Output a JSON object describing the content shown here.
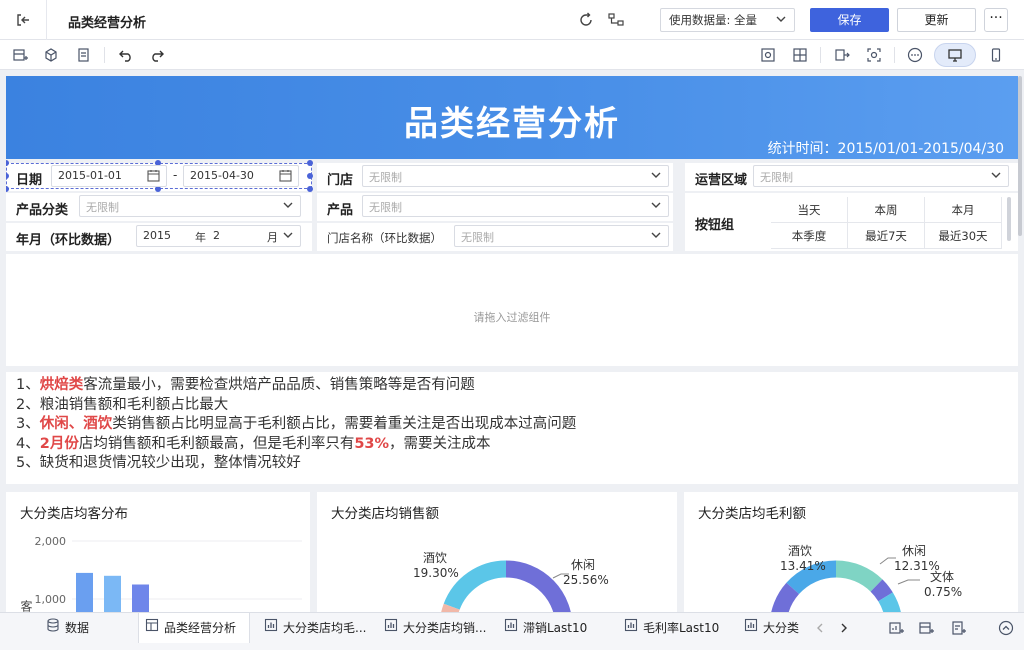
{
  "header": {
    "title": "品类经营分析",
    "data_amount_label": "使用数据量: 全量",
    "save_label": "保存",
    "update_label": "更新",
    "more_label": "···"
  },
  "banner": {
    "title": "品类经营分析",
    "stat_time": "统计时间：2015/01/01-2015/04/30"
  },
  "filters": {
    "date_label": "日期",
    "date_start": "2015-01-01",
    "date_sep": "-",
    "date_end": "2015-04-30",
    "store_label": "门店",
    "store_value": "无限制",
    "region_label": "运营区域",
    "region_value": "无限制",
    "category_label": "产品分类",
    "category_value": "无限制",
    "product_label": "产品",
    "product_value": "无限制",
    "yearmonth_label": "年月（环比数据）",
    "year_value": "2015",
    "year_unit": "年",
    "month_value": "2",
    "month_unit": "月",
    "store_name_label": "门店名称（环比数据）",
    "store_name_value": "无限制",
    "button_group_label": "按钮组",
    "buttons": [
      "当天",
      "本周",
      "本月",
      "本季度",
      "最近7天",
      "最近30天"
    ]
  },
  "drop_hint": "请拖入过滤组件",
  "notes": {
    "l1_prefix": "1、",
    "l1_hl": "烘焙类",
    "l1_rest": "客流量最小，需要检查烘焙产品品质、销售策略等是否有问题",
    "l2": "2、粮油销售额和毛利额占比最大",
    "l3_prefix": "3、",
    "l3_hl": "休闲、酒饮",
    "l3_rest": "类销售额占比明显高于毛利额占比，需要着重关注是否出现成本过高问题",
    "l4_prefix": "4、",
    "l4_hl1": "2月份",
    "l4_mid": "店均销售额和毛利额最高，但是毛利率只有",
    "l4_hl2": "53%",
    "l4_rest": "，需要关注成本",
    "l5": "5、缺货和退货情况较少出现，整体情况较好"
  },
  "cards": {
    "card1_title": "大分类店均客分布",
    "card2_title": "大分类店均销售额",
    "card3_title": "大分类店均毛利额"
  },
  "chart_data": [
    {
      "type": "bar",
      "title": "大分类店均客分布",
      "ylabel": "客流量",
      "yticks": [
        "2,000",
        "1,000"
      ],
      "series": [
        {
          "values": [
            1450,
            1400,
            1250
          ]
        }
      ],
      "colors": [
        "#6a9ff0",
        "#7bb8f5",
        "#6f86ea"
      ]
    },
    {
      "type": "pie",
      "title": "大分类店均销售额",
      "labels": [
        "酒饮",
        "休闲"
      ],
      "values_text": [
        "19.30%",
        "25.56%"
      ],
      "values": [
        19.3,
        25.56
      ],
      "colors": [
        "#5bc6e8",
        "#6f6fd8",
        "#f1b8a8"
      ]
    },
    {
      "type": "pie",
      "title": "大分类店均毛利额",
      "labels": [
        "酒饮",
        "休闲",
        "文体"
      ],
      "values_text": [
        "13.41%",
        "12.31%",
        "0.75%"
      ],
      "values": [
        13.41,
        12.31,
        0.75
      ],
      "colors": [
        "#4aa8e8",
        "#7fd4c4",
        "#6f6fd8",
        "#5bc6e8"
      ]
    }
  ],
  "bottom_tabs": {
    "data": "数据",
    "tab1": "品类经营分析",
    "tab2": "大分类店均毛...",
    "tab3": "大分类店均销...",
    "tab4": "滞销Last10",
    "tab5": "毛利率Last10",
    "tab6": "大分类"
  }
}
